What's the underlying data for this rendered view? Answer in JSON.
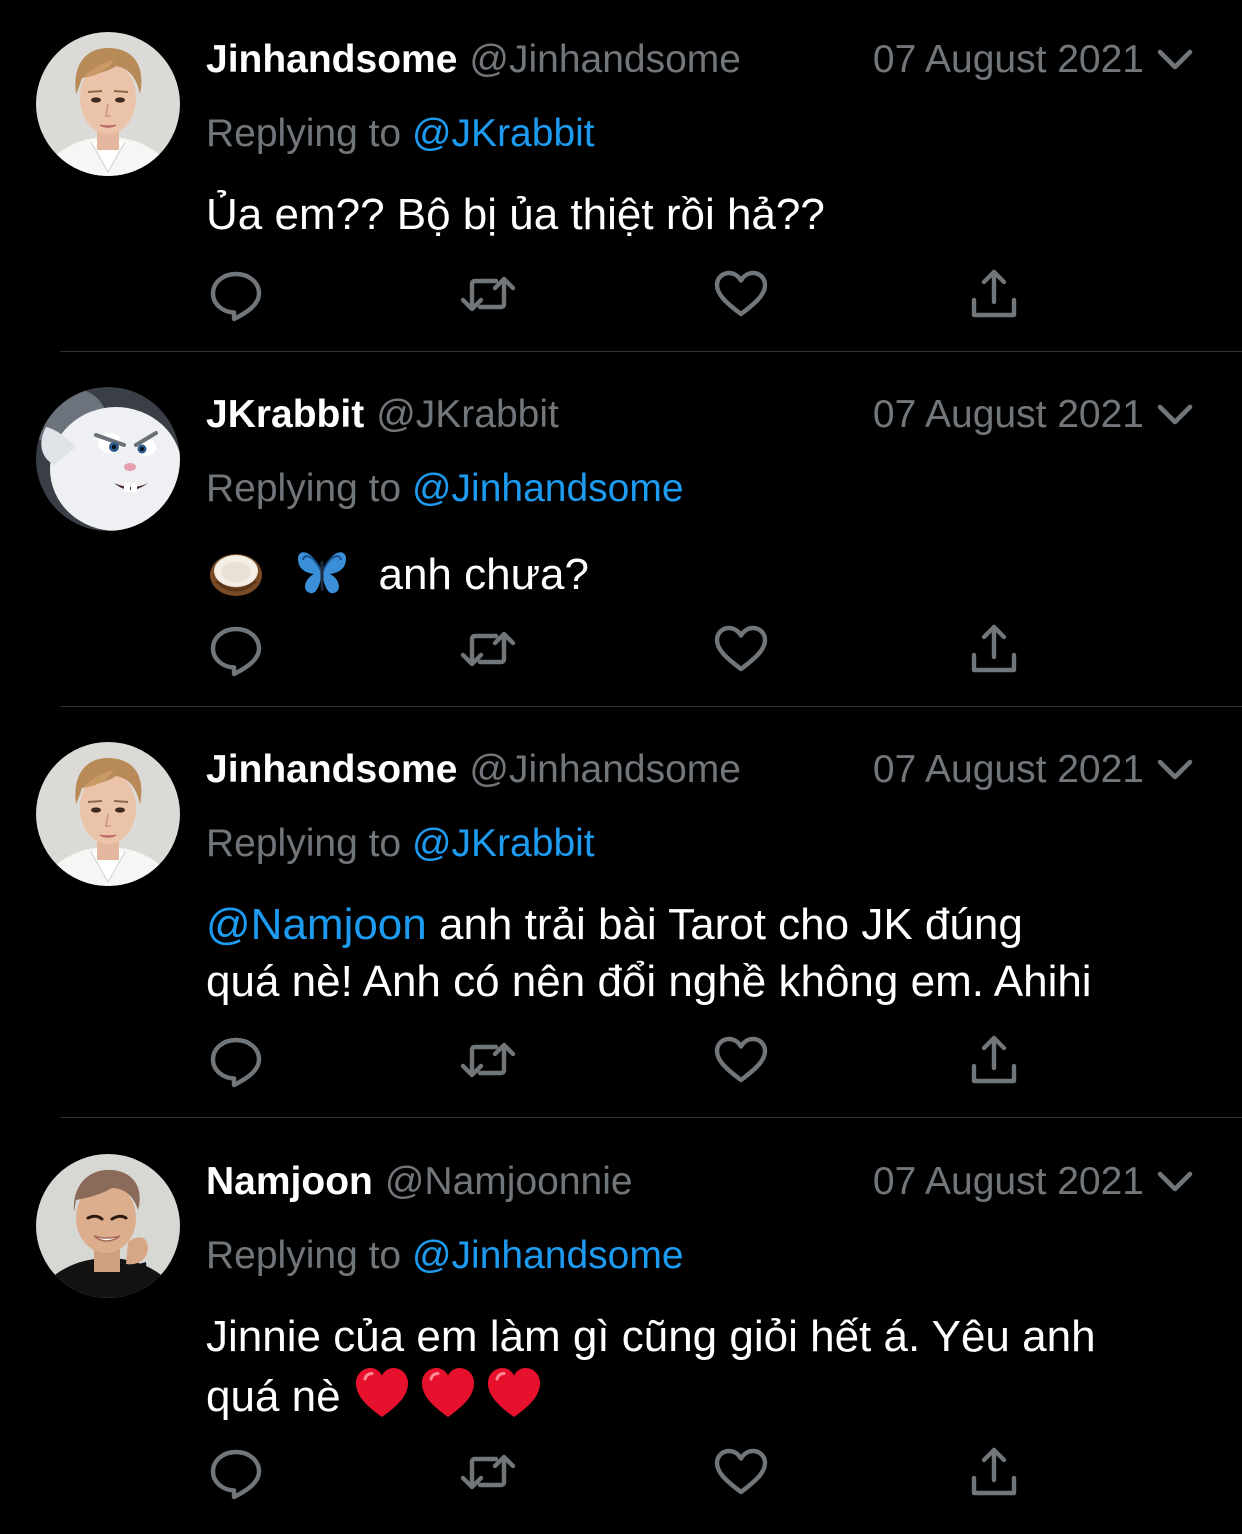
{
  "colors": {
    "background": "#000000",
    "primary_text": "#ffffff",
    "secondary_text": "#71767b",
    "accent": "#1d9bf0",
    "divider": "#2f3336",
    "heart_red": "#e8112d"
  },
  "tweets": [
    {
      "display_name": "Jinhandsome",
      "handle": "@Jinhandsome",
      "date": "07 August 2021",
      "replying_label": "Replying to",
      "replying_to": "@JKrabbit",
      "text": "Ủa em?? Bộ bị ủa thiệt rồi hả??",
      "avatar": "avatar-jin"
    },
    {
      "display_name": "JKrabbit",
      "handle": "@JKrabbit",
      "date": "07 August 2021",
      "replying_label": "Replying to",
      "replying_to": "@Jinhandsome",
      "text": "anh chưa?",
      "emojis": [
        "coconut-emoji",
        "butterfly-emoji"
      ],
      "avatar": "avatar-rabbit"
    },
    {
      "display_name": "Jinhandsome",
      "handle": "@Jinhandsome",
      "date": "07 August 2021",
      "replying_label": "Replying to",
      "replying_to": "@JKrabbit",
      "mention": "@Namjoon",
      "text_line1": " anh trải bài Tarot cho JK đúng",
      "text_line2": "quá nè! Anh có nên đổi nghề không em. Ahihi",
      "avatar": "avatar-jin"
    },
    {
      "display_name": "Namjoon",
      "handle": "@Namjoonnie",
      "date": "07 August 2021",
      "replying_label": "Replying to",
      "replying_to": "@Jinhandsome",
      "text_line1": "Jinnie của em làm gì cũng giỏi hết á. Yêu anh",
      "text_line2": "quá nè ",
      "emojis": [
        "red-heart-emoji",
        "red-heart-emoji",
        "red-heart-emoji"
      ],
      "avatar": "avatar-namjoon"
    }
  ],
  "action_icons": [
    "reply-icon",
    "retweet-icon",
    "like-icon",
    "share-icon"
  ]
}
